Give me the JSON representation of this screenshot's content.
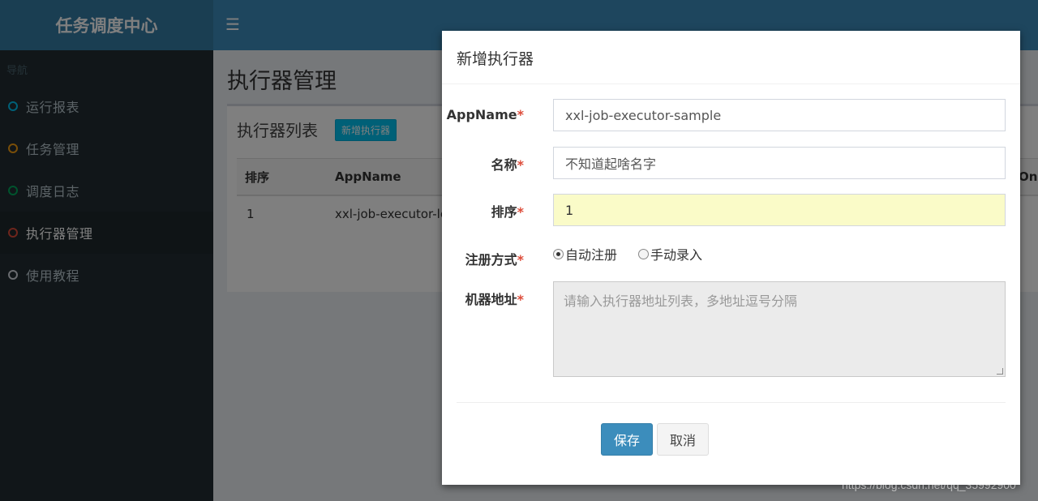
{
  "app": {
    "title": "任务调度中心"
  },
  "header": {
    "menu_icon": "hamburger-icon"
  },
  "sidebar": {
    "nav_header": "导航",
    "items": [
      {
        "label": "运行报表",
        "circle_color": "#00c0ef"
      },
      {
        "label": "任务管理",
        "circle_color": "#f39c12"
      },
      {
        "label": "调度日志",
        "circle_color": "#00a65a"
      },
      {
        "label": "执行器管理",
        "circle_color": "#dd4b39",
        "active": true
      },
      {
        "label": "使用教程",
        "circle_color": "#d2d6de"
      }
    ]
  },
  "main": {
    "page_title": "执行器管理",
    "box_title": "执行器列表",
    "add_button": "新增执行器",
    "table": {
      "headers": [
        "排序",
        "AppName",
        "Onl"
      ],
      "rows": [
        [
          "1",
          "xxl-job-executor-le"
        ]
      ]
    }
  },
  "modal": {
    "title": "新增执行器",
    "fields": {
      "appname": {
        "label": "AppName",
        "value": "xxl-job-executor-sample"
      },
      "name": {
        "label": "名称",
        "value": "不知道起啥名字"
      },
      "order": {
        "label": "排序",
        "value": "1"
      },
      "register": {
        "label": "注册方式",
        "options": [
          "自动注册",
          "手动录入"
        ],
        "selected": "自动注册"
      },
      "address": {
        "label": "机器地址",
        "placeholder": "请输入执行器地址列表，多地址逗号分隔"
      }
    },
    "required_mark": "*",
    "save_label": "保存",
    "cancel_label": "取消"
  },
  "watermark": "https://blog.csdn.net/qq_35992900"
}
